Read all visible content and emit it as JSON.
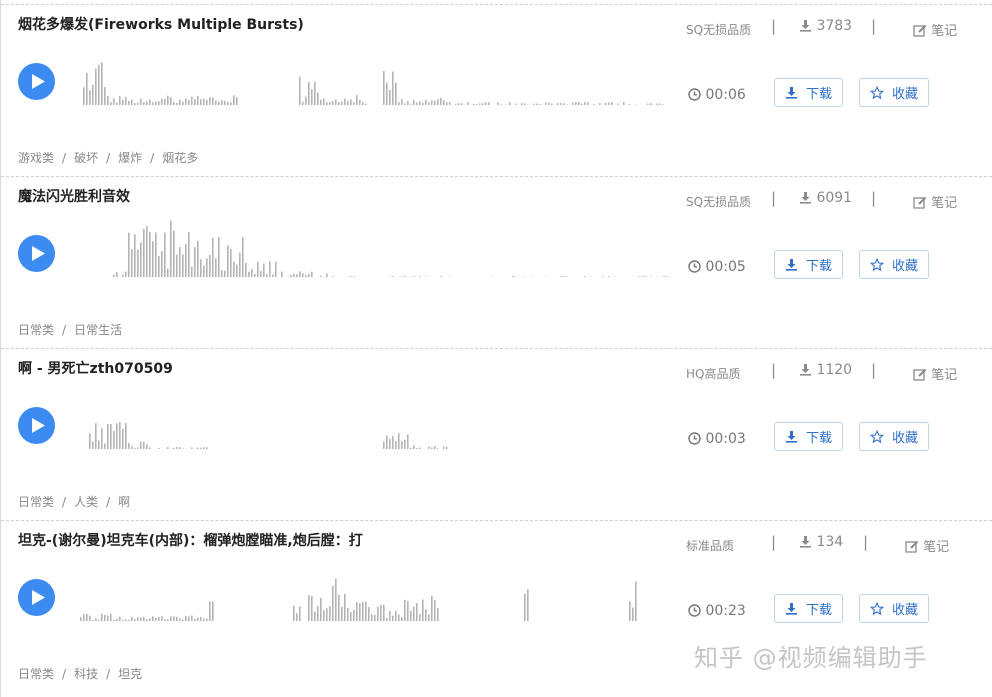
{
  "items": [
    {
      "title": "烟花多爆发(Fireworks Multiple Bursts)",
      "quality": "SQ无损品质",
      "downloads": "3783",
      "note_label": "笔记",
      "duration": "00:06",
      "download_label": "下载",
      "favorite_label": "收藏",
      "tags": [
        "游戏类",
        "破坏",
        "爆炸",
        "烟花多"
      ]
    },
    {
      "title": "魔法闪光胜利音效",
      "quality": "SQ无损品质",
      "downloads": "6091",
      "note_label": "笔记",
      "duration": "00:05",
      "download_label": "下载",
      "favorite_label": "收藏",
      "tags": [
        "日常类",
        "日常生活"
      ]
    },
    {
      "title": "啊 - 男死亡zth070509",
      "quality": "HQ高品质",
      "downloads": "1120",
      "note_label": "笔记",
      "duration": "00:03",
      "download_label": "下载",
      "favorite_label": "收藏",
      "tags": [
        "日常类",
        "人类",
        "啊"
      ]
    },
    {
      "title": "坦克-(谢尔曼)坦克车(内部)：榴弹炮膛瞄准,炮后膛：打",
      "quality": "标准品质",
      "downloads": "134",
      "note_label": "笔记",
      "duration": "00:23",
      "download_label": "下载",
      "favorite_label": "收藏",
      "tags": [
        "日常类",
        "科技",
        "坦克"
      ]
    }
  ],
  "tag_separator": "/",
  "divider": "|",
  "watermark": "知乎 @视频编辑助手",
  "colors": {
    "accent": "#3c8bf0",
    "button_text": "#2d6fc9",
    "muted": "#8a8a8a",
    "waveform": "#b4b4b4"
  },
  "icons": {
    "play": "play-icon",
    "download_count": "download-icon",
    "note": "edit-icon",
    "duration": "clock-icon",
    "download_button": "download-icon",
    "favorite_button": "star-icon"
  }
}
